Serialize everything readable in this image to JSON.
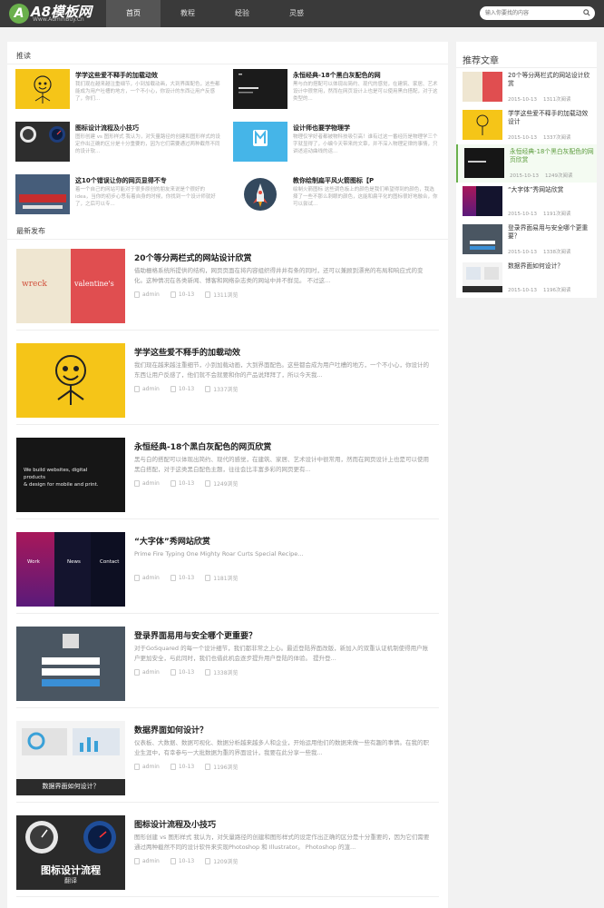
{
  "brand": {
    "name": "A8模板网",
    "url": "Www.AdminBuy.Cn"
  },
  "nav": [
    "首页",
    "教程",
    "经验",
    "灵感"
  ],
  "search": {
    "placeholder": "输入你要找的内容"
  },
  "sections": {
    "recommend": "推读",
    "latest": "最新发布"
  },
  "recommend": [
    {
      "title": "学学这些爱不释手的加载动效",
      "desc": "我们现在越来越注重细节，小到加载动画，大到界面配色，这些都能成为用户吐槽的地方，一个不小心，你设计的东西让用户反感了，你们..."
    },
    {
      "title": "永恒经典-18个黑白灰配色的网",
      "desc": "黑与白的搭配可以体现出简约、现代的感觉，在建筑、家居、艺术设计中很常用，然而在网页设计上也是可以使用黑白搭配，对于这类型的..."
    },
    {
      "title": "图标设计流程及小技巧",
      "desc": "图形创建 vs 图形样式 我认为，对矢量路径的创建和图形样式的设定作出正确的区分是十分重要的，因为它们需要通过两种截然不同的设计软..."
    },
    {
      "title": "设计师也要学物理学",
      "desc": "物理仅学好者都被物科技吸引高！谁有过这一番经历是物理学三个字就显得了，小编今天带来的文章，并不深入物理定律的事情，只讲述运动曲线的运..."
    },
    {
      "title": "这10个错误让你的网页显得不专",
      "desc": "着一个自己的网站可能对于很多原创的朋友来说是个很好的idea，当你的初步心思有着自身的时候，你找到一个设计师就好了，之后可以专..."
    },
    {
      "title": "教你绘制扁平风火箭图标【P",
      "desc": "绘制火箭图标 这些调色板上的颜色是我们希望得到的颜色，我选择了一些不那么刺眼的颜色，这能和扁平化的图标很好地融合，你可以尝试..."
    }
  ],
  "latest": [
    {
      "title": "20个等分两栏式的网站设计欣赏",
      "desc": "借助栅格系统所提供的结构，网页页面在将内容组织得井井有条的同时，还可以兼顾到漂亮的布局和响应式的变化。这种情况在各类新闻、博客和网络杂志类的网站中并不鲜见。 不过这...",
      "author": "admin",
      "date": "10-13",
      "views": "1311浏览",
      "thumb_words": [
        "wreck",
        "valentine's"
      ]
    },
    {
      "title": "学学这些爱不释手的加载动效",
      "desc": "我们现在越来越注重细节，小到加载动画，大到界面配色。这些都会成为用户吐槽的地方，一个不小心，你设计的东西让用户反感了，他们就不会就要和你的产品说拜拜了，所以今天我...",
      "author": "admin",
      "date": "10-13",
      "views": "1337浏览"
    },
    {
      "title": "永恒经典-18个黑白灰配色的网页欣赏",
      "desc": "黑与白的搭配可以体现出简约、现代的感觉，在建筑、家居、艺术设计中很常用，然而在网页设计上也是可以使用黑白搭配，对于这类黑白配色主题，往往会比丰富多彩的网页更有...",
      "author": "admin",
      "date": "10-13",
      "views": "1249浏览",
      "thumb_words": [
        "We build websites, digital products",
        "& design for mobile and print."
      ]
    },
    {
      "title": "“大字体”秀网站欣赏",
      "desc": "Prime Fire Typing One Mighty Roar Curts Special Recipe...",
      "author": "admin",
      "date": "10-13",
      "views": "1181浏览",
      "thumb_words": [
        "Work",
        "News",
        "Contact"
      ]
    },
    {
      "title": "登录界面易用与安全哪个更重要？",
      "desc": "对于GoSquared 的每一个设计细节，我们都非常之上心。最近登陆界面改版，新加入的双重认证机制使得用户账户更加安全，与此同时，我们也借此机会逐步提升用户登陆的体验。 提升登...",
      "author": "admin",
      "date": "10-13",
      "views": "1338浏览"
    },
    {
      "title": "数据界面如何设计？",
      "desc": "仪表板、大数据、数据可视化、数据分析越来越多人和企业，开始运用他们的数据来做一些有趣的事情。在我的职业生涯中，有幸参与一大批数据为重的界面设计，我要在此分享一些我...",
      "author": "admin",
      "date": "10-13",
      "views": "1196浏览",
      "thumb_words": [
        "数据界面如何设计？"
      ]
    },
    {
      "title": "图标设计流程及小技巧",
      "desc": "图形创建 vs 图形样式 我认为，对矢量路径的创建和图形样式的设定作出正确的区分是十分重要的，因为它们需要通过两种截然不同的设计软件来实现Photoshop 和 Illustrator。 Photoshop 的渲...",
      "author": "admin",
      "date": "10-13",
      "views": "1209浏览",
      "thumb_words": [
        "图标设计流程",
        "翻译"
      ]
    }
  ],
  "sidebar": {
    "title": "推荐文章",
    "items": [
      {
        "title": "20个等分两栏式的网站设计欣赏",
        "date": "2015-10-13",
        "views": "1311次阅读"
      },
      {
        "title": "学学这些爱不释手的加载动效设计",
        "date": "2015-10-13",
        "views": "1337次阅读"
      },
      {
        "title": "永恒经典-18个黑白灰配色的网页欣赏",
        "date": "2015-10-13",
        "views": "1249次阅读"
      },
      {
        "title": "“大字体”秀网站欣赏",
        "date": "2015-10-13",
        "views": "1191次阅读"
      },
      {
        "title": "登录界面易用与安全哪个更重要？",
        "date": "2015-10-13",
        "views": "1338次阅读"
      },
      {
        "title": "数据界面如何设计？",
        "date": "2015-10-13",
        "views": "1196次阅读"
      }
    ]
  },
  "colors": {
    "accent": "#6ab04c",
    "topbar": "#3a3a3a"
  }
}
